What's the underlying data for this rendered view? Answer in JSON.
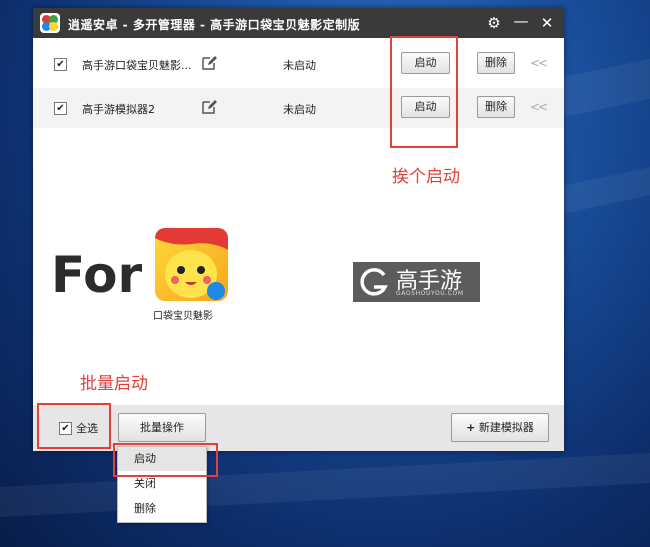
{
  "window": {
    "title": "逍遥安卓 - 多开管理器 - 高手游口袋宝贝魅影定制版",
    "settings_icon": "gear-icon",
    "minimize_icon": "minimize-icon",
    "close_icon": "close-icon"
  },
  "rows": [
    {
      "checked": "✔",
      "name": "高手游口袋宝贝魅影...",
      "status": "未启动",
      "start_label": "启动",
      "delete_label": "删除",
      "collapse": "<<"
    },
    {
      "checked": "✔",
      "name": "高手游模拟器2",
      "status": "未启动",
      "start_label": "启动",
      "delete_label": "删除",
      "collapse": "<<"
    }
  ],
  "annotations": {
    "start_each": "挨个启动",
    "batch_start": "批量启动"
  },
  "promo": {
    "for_text": "For",
    "game_name": "口袋宝贝魅影",
    "brand_name": "高手游",
    "brand_domain": "GAOSHOUYOU.COM"
  },
  "bottom": {
    "select_all_checked": "✔",
    "select_all_label": "全选",
    "batch_label": "批量操作",
    "new_sim_label": "新建模拟器",
    "new_sim_plus": "+"
  },
  "menu": {
    "items": [
      "启动",
      "关闭",
      "删除"
    ]
  },
  "colors": {
    "annotation_red": "#e2403a",
    "titlebar": "#3a3a3a"
  }
}
